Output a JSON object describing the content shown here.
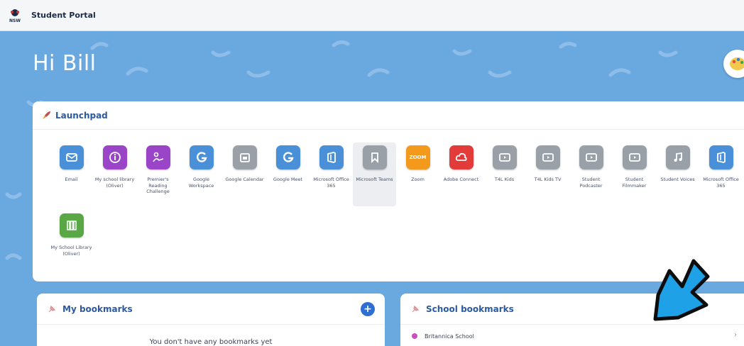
{
  "header": {
    "title": "Student Portal",
    "logo_text": "NSW"
  },
  "greeting": "Hi Bill",
  "launchpad": {
    "title": "Launchpad",
    "tiles": [
      {
        "label": "Email",
        "color": "#4a90d9",
        "icon": "envelope-icon"
      },
      {
        "label": "My school library (Oliver)",
        "color": "#9a45c8",
        "icon": "info-icon"
      },
      {
        "label": "Premier's Reading Challenge",
        "color": "#9a45c8",
        "icon": "reader-icon"
      },
      {
        "label": "Google Workspace",
        "color": "#4a90d9",
        "icon": "google-g-icon"
      },
      {
        "label": "Google Calendar",
        "color": "#9aa0a8",
        "icon": "calendar-icon"
      },
      {
        "label": "Google Meet",
        "color": "#4a90d9",
        "icon": "google-g-icon"
      },
      {
        "label": "Microsoft Office 365",
        "color": "#4a90d9",
        "icon": "office-icon"
      },
      {
        "label": "Microsoft Teams",
        "color": "#9aa0a8",
        "icon": "bookmark-icon"
      },
      {
        "label": "Zoom",
        "color": "#f39a1c",
        "icon": "zoom-icon",
        "icon_text": "ZOOM"
      },
      {
        "label": "Adobe Connect",
        "color": "#e33a3a",
        "icon": "adobe-cloud-icon"
      },
      {
        "label": "T4L Kids",
        "color": "#9aa0a8",
        "icon": "video-icon"
      },
      {
        "label": "T4L Kids TV",
        "color": "#9aa0a8",
        "icon": "video-icon"
      },
      {
        "label": "Student Podcaster",
        "color": "#9aa0a8",
        "icon": "video-icon"
      },
      {
        "label": "Student Filmmaker",
        "color": "#9aa0a8",
        "icon": "video-icon"
      },
      {
        "label": "Student Voices",
        "color": "#9aa0a8",
        "icon": "music-icon"
      },
      {
        "label": "Microsoft Office 365",
        "color": "#4a90d9",
        "icon": "office-icon"
      },
      {
        "label": "My School Library (Oliver)",
        "color": "#5aa845",
        "icon": "books-icon"
      }
    ]
  },
  "my_bookmarks": {
    "title": "My bookmarks",
    "empty_message": "You don't have any bookmarks yet"
  },
  "school_bookmarks": {
    "title": "School bookmarks",
    "items": [
      {
        "label": "Britannica School",
        "dot_color": "#c94fc0"
      }
    ]
  },
  "colors": {
    "background": "#6aa8e0",
    "accent": "#2c5aa0",
    "arrow": "#1ea1e6"
  }
}
